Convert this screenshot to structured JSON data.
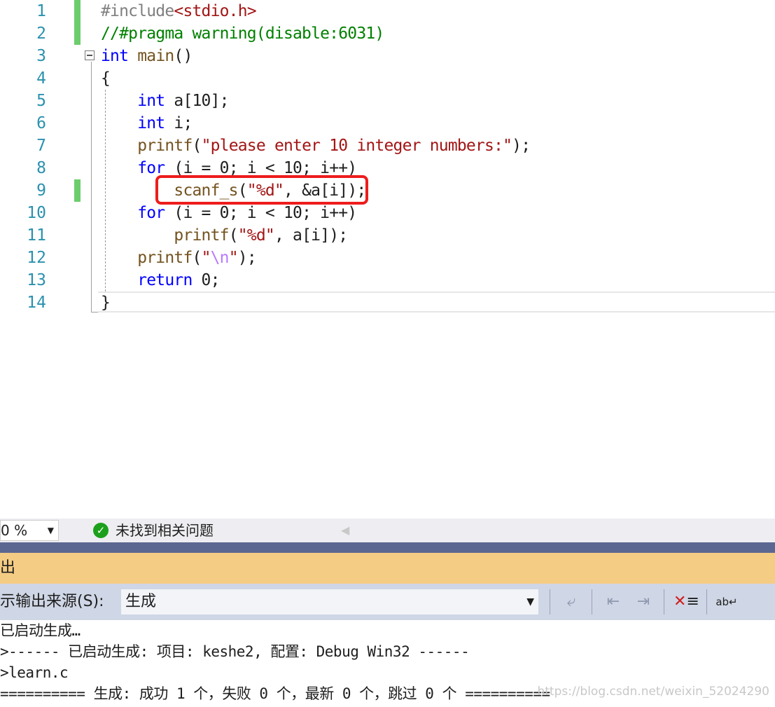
{
  "editor": {
    "line_numbers": [
      "1",
      "2",
      "3",
      "4",
      "5",
      "6",
      "7",
      "8",
      "9",
      "10",
      "11",
      "12",
      "13",
      "14"
    ],
    "lines": [
      [
        {
          "t": "#include",
          "c": "pp"
        },
        {
          "t": "<stdio.h>",
          "c": "str"
        }
      ],
      [
        {
          "t": "//#pragma warning(disable:6031)",
          "c": "cm"
        }
      ],
      [
        {
          "t": "int",
          "c": "kw"
        },
        {
          "t": " ",
          "c": ""
        },
        {
          "t": "main",
          "c": "fn"
        },
        {
          "t": "()",
          "c": ""
        }
      ],
      [
        {
          "t": "{",
          "c": ""
        }
      ],
      [
        {
          "t": "    ",
          "c": ""
        },
        {
          "t": "int",
          "c": "kw"
        },
        {
          "t": " a[10];",
          "c": ""
        }
      ],
      [
        {
          "t": "    ",
          "c": ""
        },
        {
          "t": "int",
          "c": "kw"
        },
        {
          "t": " i;",
          "c": ""
        }
      ],
      [
        {
          "t": "    ",
          "c": ""
        },
        {
          "t": "printf",
          "c": "fn"
        },
        {
          "t": "(",
          "c": ""
        },
        {
          "t": "\"please enter 10 integer numbers:\"",
          "c": "str"
        },
        {
          "t": ");",
          "c": ""
        }
      ],
      [
        {
          "t": "    ",
          "c": ""
        },
        {
          "t": "for",
          "c": "kw"
        },
        {
          "t": " (i = 0; i < 10; i++)",
          "c": ""
        }
      ],
      [
        {
          "t": "        ",
          "c": ""
        },
        {
          "t": "scanf_s",
          "c": "fn"
        },
        {
          "t": "(",
          "c": ""
        },
        {
          "t": "\"%d\"",
          "c": "str"
        },
        {
          "t": ", &a[i]);",
          "c": ""
        }
      ],
      [
        {
          "t": "    ",
          "c": ""
        },
        {
          "t": "for",
          "c": "kw"
        },
        {
          "t": " (i = 0; i < 10; i++)",
          "c": ""
        }
      ],
      [
        {
          "t": "        ",
          "c": ""
        },
        {
          "t": "printf",
          "c": "fn"
        },
        {
          "t": "(",
          "c": ""
        },
        {
          "t": "\"%d\"",
          "c": "str"
        },
        {
          "t": ", a[i]);",
          "c": ""
        }
      ],
      [
        {
          "t": "    ",
          "c": ""
        },
        {
          "t": "printf",
          "c": "fn"
        },
        {
          "t": "(",
          "c": ""
        },
        {
          "t": "\"",
          "c": "str"
        },
        {
          "t": "\\n",
          "c": "esc"
        },
        {
          "t": "\"",
          "c": "str"
        },
        {
          "t": ");",
          "c": ""
        }
      ],
      [
        {
          "t": "    ",
          "c": ""
        },
        {
          "t": "return",
          "c": "kw"
        },
        {
          "t": " 0;",
          "c": ""
        }
      ],
      [
        {
          "t": "}",
          "c": ""
        }
      ]
    ]
  },
  "status": {
    "zoom": "0 %",
    "issues_text": "未找到相关问题",
    "issues_icon": "check-circle-icon",
    "ok_color": "#1ca01c"
  },
  "output": {
    "title": "出",
    "source_label": "示输出来源(S):",
    "source_value": "生成",
    "lines": [
      "已启动生成…",
      ">------ 已启动生成: 项目: keshe2, 配置: Debug Win32 ------",
      ">learn.c",
      "========== 生成: 成功 1 个，失败 0 个，最新 0 个，跳过 0 个 =========="
    ],
    "watermark": "https://blog.csdn.net/weixin_52024290"
  },
  "colors": {
    "highlight_box": "#ee1c1c",
    "output_title_bg": "#f5cc84",
    "toolbar_bg": "#cfd6e5"
  }
}
